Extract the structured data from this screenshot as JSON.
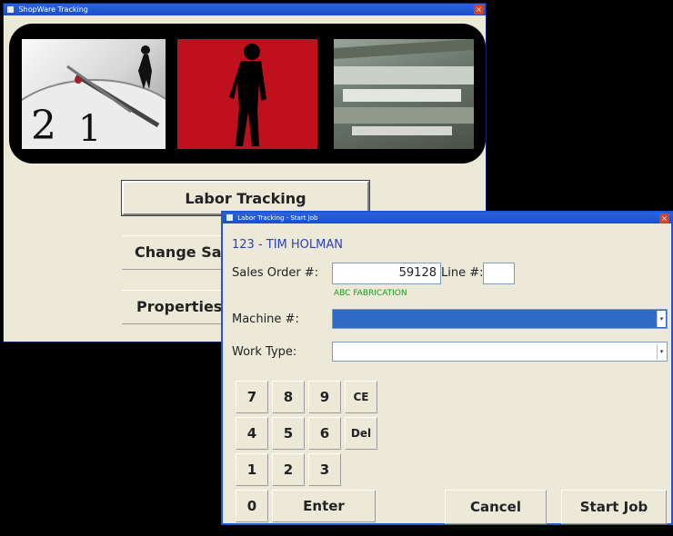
{
  "main_window": {
    "title": "ShopWare Tracking",
    "buttons": {
      "labor_tracking": "Labor Tracking",
      "change_sales": "Change Sa",
      "properties": "Properties"
    }
  },
  "dialog": {
    "title": "Labor Tracking - Start Job",
    "employee": "123 - TIM HOLMAN",
    "sales_order_label": "Sales Order #:",
    "sales_order_value": "59128",
    "line_label": "Line #:",
    "line_value": "",
    "customer": "ABC FABRICATION",
    "machine_label": "Machine #:",
    "machine_value": "",
    "work_type_label": "Work Type:",
    "work_type_value": "",
    "keypad": {
      "k7": "7",
      "k8": "8",
      "k9": "9",
      "ce": "CE",
      "k4": "4",
      "k5": "5",
      "k6": "6",
      "del": "Del",
      "k1": "1",
      "k2": "2",
      "k3": "3",
      "k0": "0",
      "enter": "Enter"
    },
    "cancel": "Cancel",
    "start_job": "Start Job"
  },
  "colors": {
    "title_bar": "#1a4fc9",
    "selection": "#3169c6",
    "banner_red": "#c0101e",
    "customer_text": "#1a9a1a"
  }
}
